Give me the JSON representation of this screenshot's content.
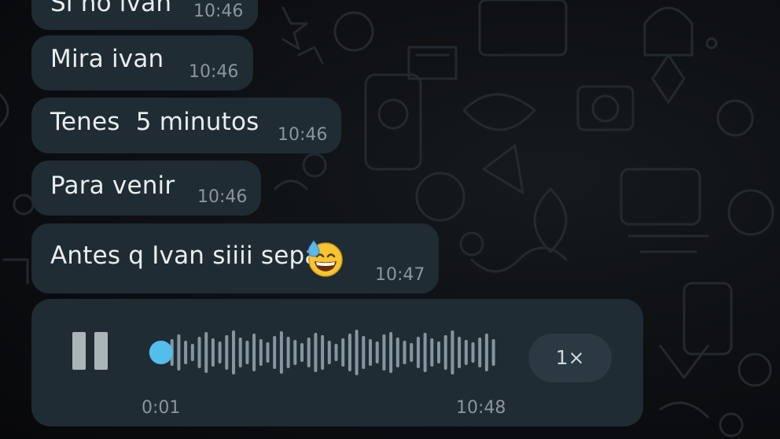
{
  "chat": {
    "messages": [
      {
        "text": "Si no ivan",
        "time": "10:46"
      },
      {
        "text": "Mira ivan",
        "time": "10:46"
      },
      {
        "text": "Tenes  5 minutos",
        "time": "10:46"
      },
      {
        "text": "Para venir",
        "time": "10:46"
      },
      {
        "text": "Antes q Ivan siiii sepa",
        "emoji": "grinning-face-with-sweat-icon",
        "time": "10:47"
      }
    ],
    "voice_message": {
      "state": "playing",
      "control_icon": "pause-icon",
      "elapsed": "0:01",
      "time": "10:48",
      "speed": "1×",
      "progress": 0.02
    }
  },
  "colors": {
    "bubble_bg": "#1f2c34",
    "progress_dot": "#53bdeb",
    "waveform": "#8696a0"
  }
}
